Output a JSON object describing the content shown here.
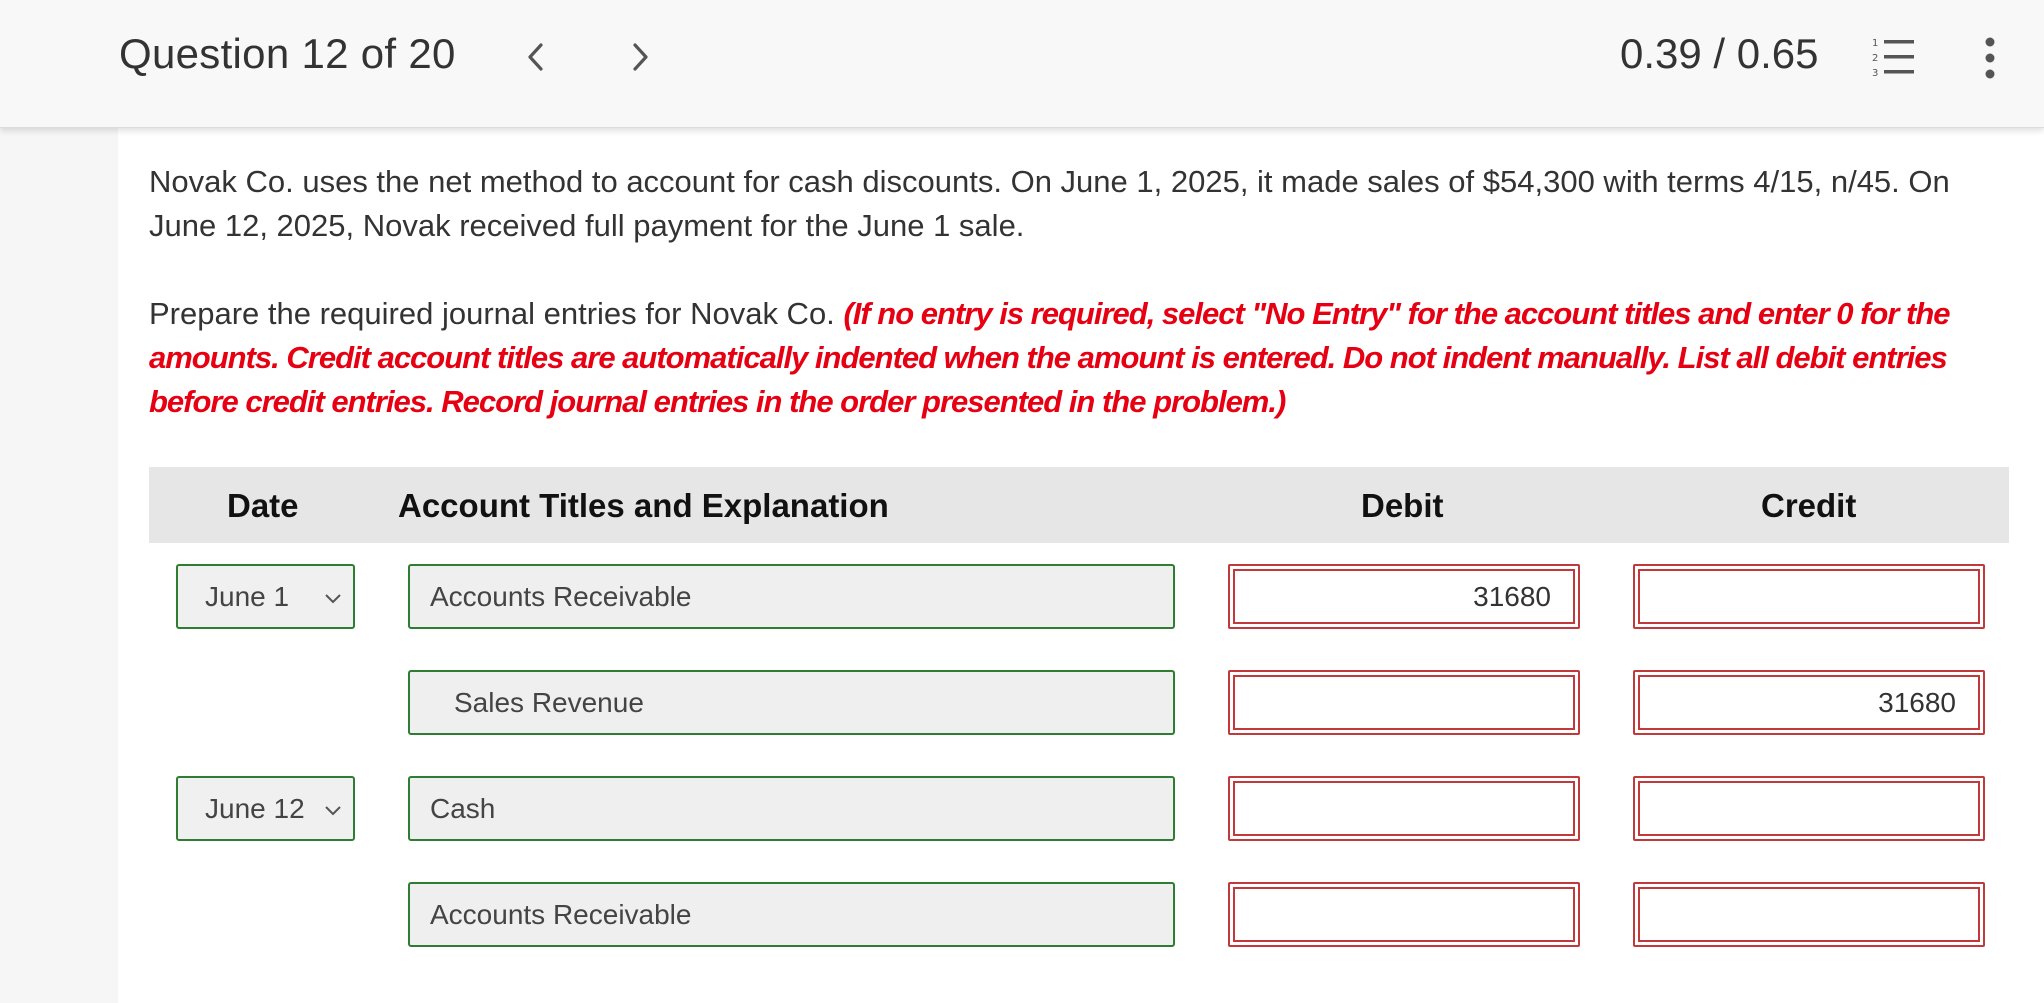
{
  "header": {
    "question_label": "Question 12 of 20",
    "score": "0.39 / 0.65"
  },
  "problem": {
    "text": "Novak Co. uses the net method to account for cash discounts. On June 1, 2025, it made sales of $54,300 with terms 4/15, n/45. On June 12, 2025, Novak received full payment for the June 1 sale."
  },
  "instructions": {
    "lead": "Prepare the required journal entries for Novak Co.",
    "hint": "(If no entry is required, select \"No Entry\" for the account titles and enter 0 for the amounts. Credit account titles are automatically indented when the amount is entered. Do not indent manually. List all debit entries before credit entries. Record journal entries in the order presented in the problem.)"
  },
  "table": {
    "headers": {
      "date": "Date",
      "account": "Account Titles and Explanation",
      "debit": "Debit",
      "credit": "Credit"
    },
    "rows": [
      {
        "date": "June 1",
        "account": "Accounts Receivable",
        "debit": "31680",
        "credit": ""
      },
      {
        "date": "",
        "account": "Sales Revenue",
        "debit": "",
        "credit": "31680"
      },
      {
        "date": "June 12",
        "account": "Cash",
        "debit": "",
        "credit": ""
      },
      {
        "date": "",
        "account": "Accounts Receivable",
        "debit": "",
        "credit": ""
      }
    ]
  },
  "icons": {
    "prev": "chevron-left-icon",
    "next": "chevron-right-icon",
    "list": "numbered-list-icon",
    "more": "more-vertical-icon"
  },
  "colors": {
    "hint_red": "#e60012",
    "valid_green": "#2e7d32",
    "error_red": "#c2393c"
  }
}
